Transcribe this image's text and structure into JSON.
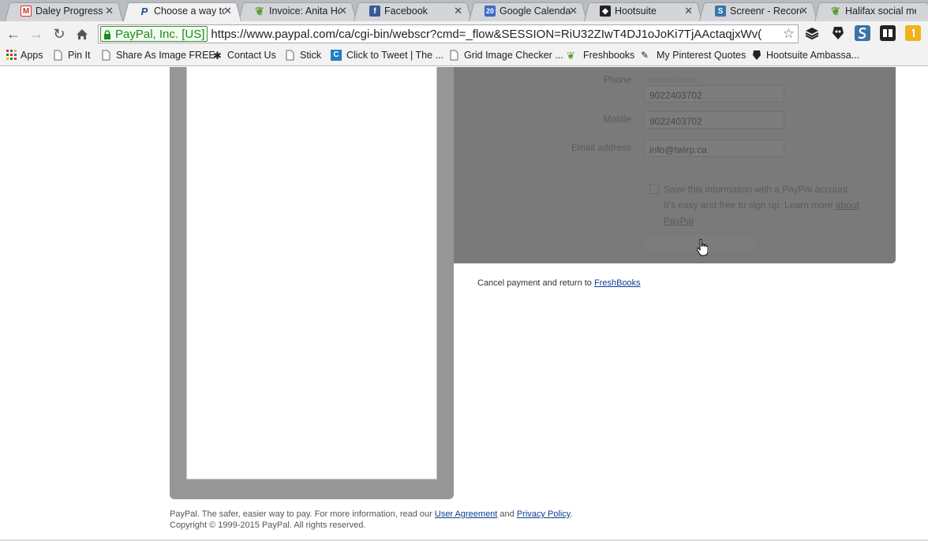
{
  "browser": {
    "tabs": [
      {
        "title": "Daley Progress In",
        "icon": "gmail-icon",
        "color": "#d93025",
        "glyph": "M"
      },
      {
        "title": "Choose a way to",
        "icon": "paypal-icon",
        "color": "#1a4a9c",
        "glyph": "P",
        "active": true
      },
      {
        "title": "Invoice: Anita Ho",
        "icon": "freshbooks-leaf-icon",
        "color": "#5c9e2e",
        "glyph": "✿"
      },
      {
        "title": "Facebook",
        "icon": "facebook-icon",
        "color": "#3b5998",
        "glyph": "f"
      },
      {
        "title": "Google Calendar",
        "icon": "calendar-icon",
        "color": "#3a6bc7",
        "glyph": "20"
      },
      {
        "title": "Hootsuite",
        "icon": "hootsuite-owl-icon",
        "color": "#222222",
        "glyph": "◆"
      },
      {
        "title": "Screenr - Record",
        "icon": "screenr-icon",
        "color": "#3a74a8",
        "glyph": "S"
      },
      {
        "title": "Halifax social me",
        "icon": "halifax-icon",
        "color": "#5c9e2e",
        "glyph": "✿"
      }
    ],
    "address": {
      "ev_label": "PayPal, Inc. [US]",
      "url": "https://www.paypal.com/ca/cgi-bin/webscr?cmd=_flow&SESSION=RiU32ZIwT4DJ1oJoKi7TjAActaqjxWv("
    },
    "bookmarks": [
      {
        "label": "Apps",
        "icon": "apps-grid-icon"
      },
      {
        "label": "Pin It",
        "icon": "page-icon"
      },
      {
        "label": "Share As Image FREE",
        "icon": "page-icon"
      },
      {
        "label": "Contact Us",
        "icon": "contact-icon"
      },
      {
        "label": "Stick",
        "icon": "page-icon"
      },
      {
        "label": "Click to Tweet | The ...",
        "icon": "clicktotweet-icon"
      },
      {
        "label": "Grid Image Checker ...",
        "icon": "page-icon"
      },
      {
        "label": "Freshbooks",
        "icon": "freshbooks-leaf-icon"
      },
      {
        "label": "My Pinterest Quotes",
        "icon": "pin-icon"
      },
      {
        "label": "Hootsuite Ambassa...",
        "icon": "hootsuite-owl-icon"
      }
    ]
  },
  "form": {
    "phone_label": "Phone",
    "phone_placeholder": "xxx-xxx-xxxx",
    "phone_value": "9022403702",
    "mobile_label": "Mobile",
    "mobile_value": "9022403702",
    "email_label": "Email address",
    "email_value": "info@twirp.ca",
    "save_line1": "Save this information with a PayPal account",
    "save_line2": "It's easy and free to sign up. Learn more",
    "save_link": "about PayPal"
  },
  "cancel": {
    "text": "Cancel payment and return to ",
    "link": "FreshBooks"
  },
  "footer": {
    "line1_text": "PayPal. The safer, easier way to pay. For more information, read our ",
    "user_agreement": "User Agreement",
    "and": " and ",
    "privacy_policy": "Privacy Policy",
    "period": ".",
    "copyright": "Copyright © 1999-2015 PayPal. All rights reserved."
  }
}
